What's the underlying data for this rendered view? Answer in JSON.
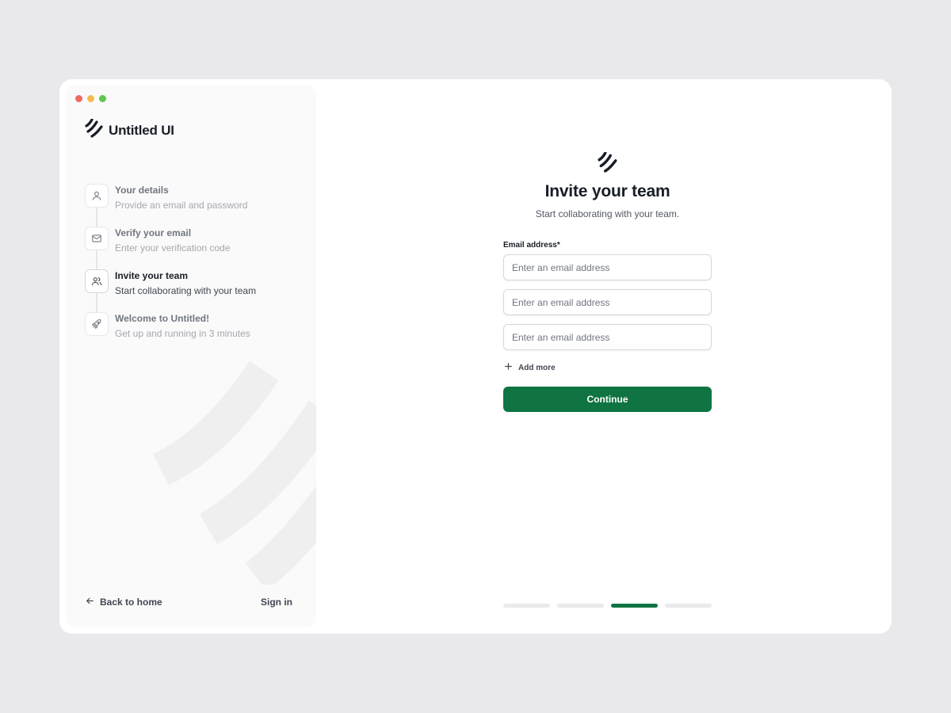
{
  "brand": {
    "name": "Untitled UI"
  },
  "steps": [
    {
      "title": "Your details",
      "description": "Provide an email and password",
      "icon": "user-icon",
      "state": "inactive"
    },
    {
      "title": "Verify your email",
      "description": "Enter your verification code",
      "icon": "mail-icon",
      "state": "inactive"
    },
    {
      "title": "Invite your team",
      "description": "Start collaborating with your team",
      "icon": "users-icon",
      "state": "active"
    },
    {
      "title": "Welcome to Untitled!",
      "description": "Get up and running in 3 minutes",
      "icon": "rocket-icon",
      "state": "inactive"
    }
  ],
  "footer": {
    "back_label": "Back to home",
    "sign_in_label": "Sign in"
  },
  "form": {
    "title": "Invite your team",
    "subtitle": "Start collaborating with your team.",
    "email_label": "Email address*",
    "email_placeholder": "Enter an email address",
    "emails": [
      "",
      "",
      ""
    ],
    "add_more_label": "Add more",
    "continue_label": "Continue"
  },
  "progress": {
    "total_steps": 4,
    "current_step": 3
  },
  "colors": {
    "accent": "#0f7442",
    "background": "#e9e9eb"
  }
}
